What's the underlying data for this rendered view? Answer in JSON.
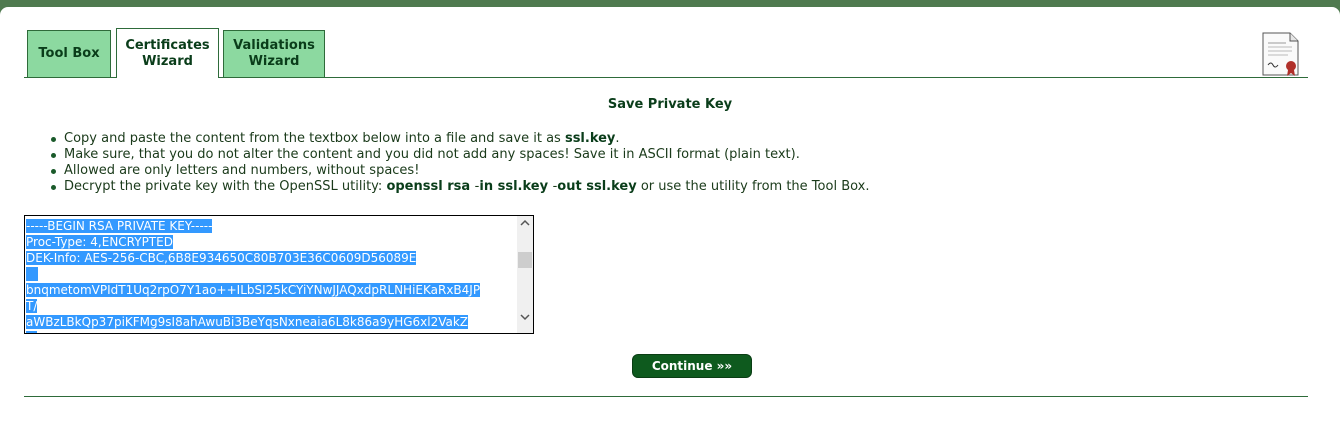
{
  "tabs": [
    {
      "label": "Tool Box",
      "active": false
    },
    {
      "label": "Certificates\nWizard",
      "active": true
    },
    {
      "label": "Validations\nWizard",
      "active": false
    }
  ],
  "page_title": "Save Private Key",
  "instructions": {
    "line1_pre": "Copy and paste the content from the textbox below into a file and save it as ",
    "line1_file": "ssl.key",
    "line1_post": ".",
    "line2": "Make sure, that you do not alter the content and you did not add any spaces! Save it in ASCII format (plain text).",
    "line3": "Allowed are only letters and numbers, without spaces!",
    "line4_pre": "Decrypt the private key with the OpenSSL utility: ",
    "line4_cmd1": "openssl rsa ",
    "line4_dash1": "-",
    "line4_cmd2": "in ssl.key ",
    "line4_dash2": "-",
    "line4_cmd3": "out ssl.key",
    "line4_post": " or use the utility from the Tool Box."
  },
  "key_lines": [
    "-----BEGIN RSA PRIVATE KEY-----",
    "Proc-Type: 4,ENCRYPTED",
    "DEK-Info: AES-256-CBC,6B8E934650C80B703E36C0609D56089E",
    "",
    "bnqmetomVPIdT1Uq2rpO7Y1ao++ILbSI25kCYiYNwJJAQxdpRLNHiEKaRxB4JP",
    "T/",
    "aWBzLBkQp37piKFMg9sI8ahAwuBi3BeYqsNxneaia6L8k86a9yHG6xl2VakZ",
    "..."
  ],
  "continue_label": "Continue »»",
  "icons": {
    "certificate": "certificate-icon",
    "scroll_up": "chevron-up-icon",
    "scroll_down": "chevron-down-icon"
  },
  "colors": {
    "accent": "#0e5a1e",
    "tab": "#8cd9a0",
    "selection": "#3399ff",
    "frame": "#4f7a4f"
  }
}
